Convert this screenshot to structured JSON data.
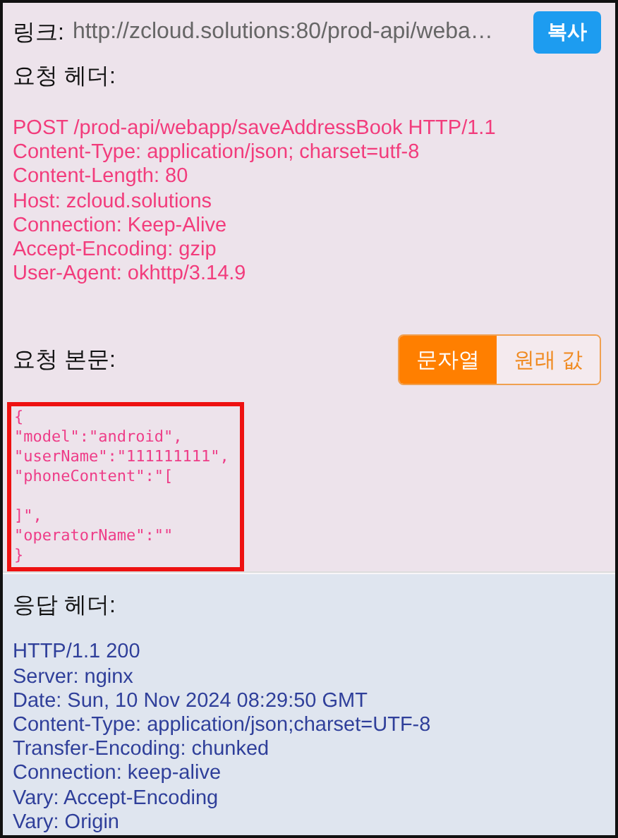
{
  "link": {
    "label": "링크:",
    "url": "http://zcloud.solutions:80/prod-api/weba…",
    "copy_button": "복사"
  },
  "request_headers": {
    "title": "요청 헤더:",
    "lines": [
      "POST /prod-api/webapp/saveAddressBook HTTP/1.1",
      "Content-Type: application/json; charset=utf-8",
      "Content-Length: 80",
      "Host: zcloud.solutions",
      "Connection: Keep-Alive",
      "Accept-Encoding: gzip",
      "User-Agent: okhttp/3.14.9"
    ]
  },
  "request_body": {
    "title": "요청 본문:",
    "tabs": [
      {
        "label": "문자열",
        "selected": true
      },
      {
        "label": "원래 값",
        "selected": false
      }
    ],
    "content": "{\n\"model\":\"android\",\n\"userName\":\"111111111\",\n\"phoneContent\":\"[\n\n]\",\n\"operatorName\":\"\"\n}"
  },
  "response_headers": {
    "title": "응답 헤더:",
    "lines": [
      "HTTP/1.1 200",
      "Server: nginx",
      "Date: Sun, 10 Nov 2024 08:29:50 GMT",
      "Content-Type: application/json;charset=UTF-8",
      "Transfer-Encoding: chunked",
      "Connection: keep-alive",
      "Vary: Accept-Encoding",
      "Vary: Origin"
    ]
  }
}
